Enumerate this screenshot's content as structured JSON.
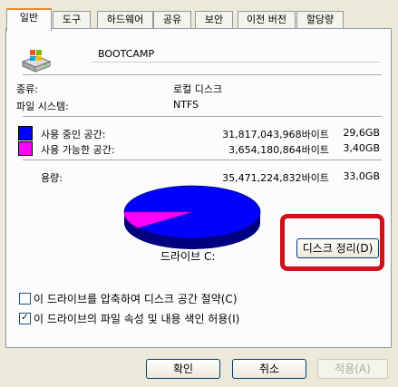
{
  "tabs": [
    {
      "label": "일반",
      "active": true
    },
    {
      "label": "도구"
    },
    {
      "label": "하드웨어"
    },
    {
      "label": "공유"
    },
    {
      "label": "보안"
    },
    {
      "label": "이전 버전"
    },
    {
      "label": "할당량"
    }
  ],
  "drive": {
    "name": "BOOTCAMP",
    "type_label": "종류:",
    "type_value": "로컬 디스크",
    "fs_label": "파일 시스템:",
    "fs_value": "NTFS"
  },
  "space": {
    "used_label": "사용 중인 공간:",
    "used_bytes": "31,817,043,968바이트",
    "used_size": "29,6GB",
    "used_color": "#0000ff",
    "free_label": "사용 가능한 공간:",
    "free_bytes": "3,654,180,864바이트",
    "free_size": "3,40GB",
    "free_color": "#ff00ff",
    "capacity_label": "용량:",
    "capacity_bytes": "35,471,224,832바이트",
    "capacity_size": "33,0GB",
    "used_fraction": 0.897
  },
  "drive_label": "드라이브 C:",
  "cleanup_button": "디스크 정리(D)",
  "options": [
    {
      "label": "이 드라이브를 압축하여 디스크 공간 절약(C)",
      "checked": false
    },
    {
      "label": "이 드라이브의 파일 속성 및 내용 색인 허용(I)",
      "checked": true
    }
  ],
  "footer": {
    "ok": "확인",
    "cancel": "취소",
    "apply": "적용(A)"
  }
}
